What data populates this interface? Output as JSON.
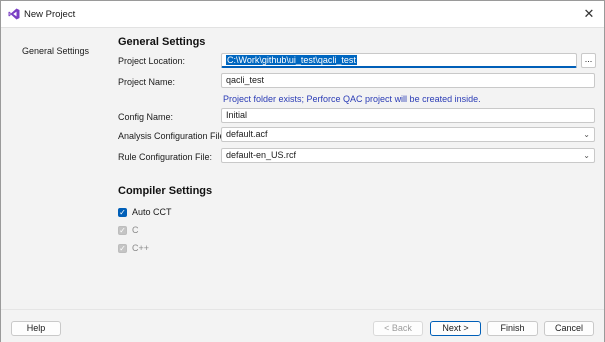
{
  "window": {
    "title": "New Project",
    "close_glyph": "✕"
  },
  "nav": {
    "items": [
      {
        "label": "General Settings"
      }
    ]
  },
  "general": {
    "heading": "General Settings",
    "project_location": {
      "label": "Project Location:",
      "value": "C:\\Work\\github\\ui_test\\qacli_test",
      "browse_label": "..."
    },
    "project_name": {
      "label": "Project Name:",
      "value": "qacli_test"
    },
    "info_message": "Project folder exists; Perforce QAC project will be created inside.",
    "config_name": {
      "label": "Config Name:",
      "value": "Initial"
    },
    "analysis_config": {
      "label": "Analysis Configuration File:",
      "value": "default.acf"
    },
    "rule_config": {
      "label": "Rule Configuration File:",
      "value": "default-en_US.rcf"
    }
  },
  "compiler": {
    "heading": "Compiler Settings",
    "options": [
      {
        "label": "Auto CCT",
        "checked": true,
        "enabled": true
      },
      {
        "label": "C",
        "checked": true,
        "enabled": false
      },
      {
        "label": "C++",
        "checked": true,
        "enabled": false
      }
    ]
  },
  "footer": {
    "help": "Help",
    "back": "< Back",
    "next": "Next >",
    "finish": "Finish",
    "cancel": "Cancel"
  },
  "colors": {
    "accent": "#005fb8",
    "info_text": "#2a3bb5",
    "selection": "#0067c0"
  },
  "icons": {
    "app": "visual-studio-icon",
    "close": "close-icon",
    "dropdown": "chevron-down-icon",
    "check": "checkmark-icon"
  }
}
